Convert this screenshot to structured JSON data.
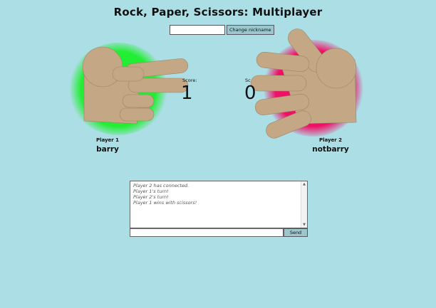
{
  "page": {
    "title": "Rock, Paper, Scissors: Multiplayer"
  },
  "nickname": {
    "value": "",
    "placeholder": "",
    "button_label": "Change nickname"
  },
  "players": {
    "p1": {
      "label": "Player 1",
      "name": "barry",
      "glow_color": "#22ee33",
      "hand": "scissors"
    },
    "p2": {
      "label": "Player 2",
      "name": "notbarry",
      "glow_color": "#ee1166",
      "hand": "paper"
    }
  },
  "scores": {
    "p1": {
      "label": "Score:",
      "value": "1"
    },
    "p2": {
      "label": "Sc",
      "value": "0"
    }
  },
  "chat": {
    "lines": [
      "Player 2 has connected.",
      "Player 1's turn!",
      "Player 2's turn!",
      "Player 1 wins with scissors!"
    ],
    "input_value": "",
    "send_label": "Send"
  },
  "colors": {
    "background": "#acdee6",
    "hand": "#c4a885",
    "hand_shadow": "#a08868"
  }
}
